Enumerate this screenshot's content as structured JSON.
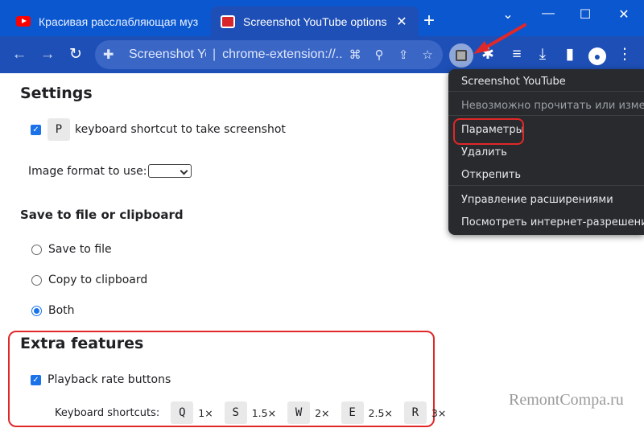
{
  "tabs": [
    {
      "title": "Красивая расслабляющая музыка",
      "icon": "youtube-icon",
      "active": false
    },
    {
      "title": "Screenshot YouTube options",
      "icon": "extension-favicon-icon",
      "active": true
    }
  ],
  "toolbar": {
    "omnibox_site": "Screenshot YouTube",
    "omnibox_url": "chrome-extension://...",
    "separator": "|"
  },
  "settings": {
    "title": "Settings",
    "shortcut_key": "P",
    "shortcut_label": "keyboard shortcut to take screenshot",
    "image_format_label": "Image format to use:",
    "image_format_value": ""
  },
  "save": {
    "title": "Save to file or clipboard",
    "options": [
      {
        "label": "Save to file",
        "selected": false
      },
      {
        "label": "Copy to clipboard",
        "selected": false
      },
      {
        "label": "Both",
        "selected": true
      }
    ]
  },
  "extra": {
    "title": "Extra features",
    "playback_label": "Playback rate buttons",
    "shortcuts_label": "Keyboard shortcuts:",
    "shortcuts": [
      {
        "key": "Q",
        "rate": "1×"
      },
      {
        "key": "S",
        "rate": "1.5×"
      },
      {
        "key": "W",
        "rate": "2×"
      },
      {
        "key": "E",
        "rate": "2.5×"
      },
      {
        "key": "R",
        "rate": "3×"
      }
    ]
  },
  "menu": {
    "items": [
      {
        "label": "Screenshot YouTube",
        "dim": false
      },
      {
        "label": "Невозможно прочитать или изменить",
        "dim": true
      },
      {
        "label": "Параметры",
        "dim": false
      },
      {
        "label": "Удалить",
        "dim": false
      },
      {
        "label": "Открепить",
        "dim": false
      },
      {
        "label": "Управление расширениями",
        "dim": false
      },
      {
        "label": "Посмотреть интернет-разрешения",
        "dim": false
      }
    ]
  },
  "watermark": "RemontCompa.ru",
  "colors": {
    "accent": "#0b57d0",
    "highlight": "#e02828",
    "menu_bg": "#292a2d"
  }
}
